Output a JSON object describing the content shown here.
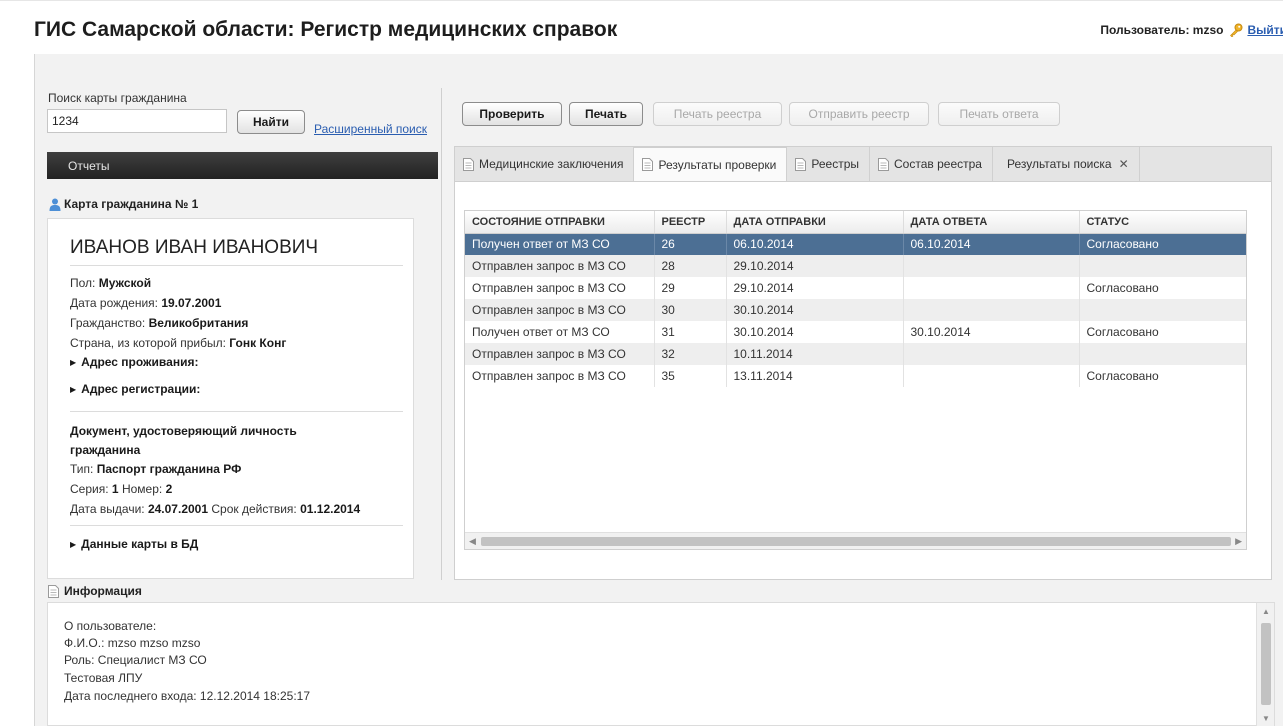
{
  "header": {
    "title": "ГИС Самарской области: Регистр медицинских справок",
    "user_label": "Пользователь: mzso",
    "logout_label": "Выйти"
  },
  "search": {
    "label": "Поиск карты гражданина",
    "value": "1234",
    "find_label": "Найти",
    "advanced_label": "Расширенный поиск"
  },
  "reports": {
    "label": "Отчеты"
  },
  "card": {
    "title": "Карта гражданина № 1",
    "name": "ИВАНОВ ИВАН ИВАНОВИЧ",
    "sex_label": "Пол:",
    "sex_value": "Мужской",
    "birth_label": "Дата рождения:",
    "birth_value": "19.07.2001",
    "citizenship_label": "Гражданство:",
    "citizenship_value": "Великобритания",
    "country_label": "Страна, из которой прибыл:",
    "country_value": "Гонк Конг",
    "residence_address": "Адрес проживания:",
    "registration_address": "Адрес регистрации:",
    "document_title_1": "Документ, удостоверяющий личность",
    "document_title_2": "гражданина",
    "doc_type_label": "Тип:",
    "doc_type_value": "Паспорт гражданина РФ",
    "series_label": "Серия:",
    "series_value": "1",
    "number_label": "Номер:",
    "number_value": "2",
    "issue_label": "Дата выдачи:",
    "issue_value": "24.07.2001",
    "expiry_label": "Срок действия:",
    "expiry_value": "01.12.2014",
    "db_data": "Данные карты в БД"
  },
  "toolbar": {
    "check": "Проверить",
    "print": "Печать",
    "print_registry": "Печать реестра",
    "send_registry": "Отправить реестр",
    "print_answer": "Печать ответа"
  },
  "tabs": [
    {
      "label": "Медицинские заключения"
    },
    {
      "label": "Результаты проверки"
    },
    {
      "label": "Реестры"
    },
    {
      "label": "Состав реестра"
    },
    {
      "label": "Результаты поиска"
    }
  ],
  "grid": {
    "columns": [
      "СОСТОЯНИЕ ОТПРАВКИ",
      "РЕЕСТР",
      "ДАТА ОТПРАВКИ",
      "ДАТА ОТВЕТА",
      "СТАТУС"
    ],
    "rows": [
      [
        "Получен ответ от МЗ СО",
        "26",
        "06.10.2014",
        "06.10.2014",
        "Согласовано"
      ],
      [
        "Отправлен запрос в МЗ СО",
        "28",
        "29.10.2014",
        "",
        ""
      ],
      [
        "Отправлен запрос в МЗ СО",
        "29",
        "29.10.2014",
        "",
        "Согласовано"
      ],
      [
        "Отправлен запрос в МЗ СО",
        "30",
        "30.10.2014",
        "",
        ""
      ],
      [
        "Получен ответ от МЗ СО",
        "31",
        "30.10.2014",
        "30.10.2014",
        "Согласовано"
      ],
      [
        "Отправлен запрос в МЗ СО",
        "32",
        "10.11.2014",
        "",
        ""
      ],
      [
        "Отправлен запрос в МЗ СО",
        "35",
        "13.11.2014",
        "",
        "Согласовано"
      ]
    ]
  },
  "info": {
    "title": "Информация",
    "lines": [
      "О пользователе:",
      "Ф.И.О.: mzso mzso mzso",
      "Роль: Специалист МЗ СО",
      "Тестовая ЛПУ",
      "Дата последнего входа: 12.12.2014 18:25:17"
    ]
  },
  "colors": {
    "selected_row": "#4c6f94",
    "link": "#2a5db0",
    "reports_bar": "#2b2b2b"
  }
}
